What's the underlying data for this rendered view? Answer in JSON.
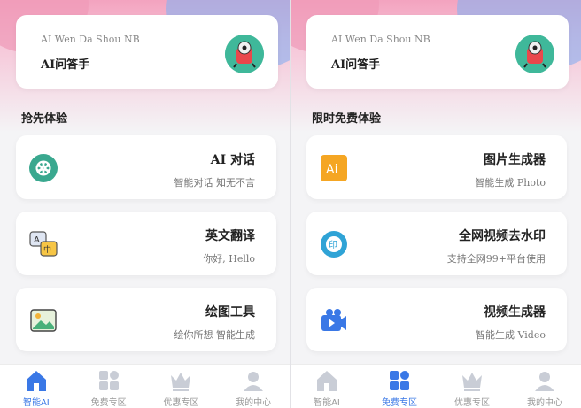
{
  "screens": [
    {
      "header": {
        "subtitle": "AI Wen Da Shou NB",
        "title": "AI问答手"
      },
      "section_title": "抢先体验",
      "cards": [
        {
          "title": "AI 对话",
          "desc": "智能对话 知无不言",
          "icon": "chat-ai-icon"
        },
        {
          "title": "英文翻译",
          "desc": "你好, Hello",
          "icon": "translate-icon"
        },
        {
          "title": "绘图工具",
          "desc": "绘你所想 智能生成",
          "icon": "image-icon"
        }
      ],
      "tabs": [
        {
          "label": "智能AI",
          "icon": "home-icon",
          "active": true
        },
        {
          "label": "免费专区",
          "icon": "grid-icon",
          "active": false
        },
        {
          "label": "优惠专区",
          "icon": "crown-icon",
          "active": false
        },
        {
          "label": "我的中心",
          "icon": "user-icon",
          "active": false
        }
      ]
    },
    {
      "header": {
        "subtitle": "AI Wen Da Shou NB",
        "title": "AI问答手"
      },
      "section_title": "限时免费体验",
      "cards": [
        {
          "title": "图片生成器",
          "desc": "智能生成 Photo",
          "icon": "ai-image-icon"
        },
        {
          "title": "全网视频去水印",
          "desc": "支持全网99+平台使用",
          "icon": "watermark-icon"
        },
        {
          "title": "视频生成器",
          "desc": "智能生成 Video",
          "icon": "video-icon"
        }
      ],
      "tabs": [
        {
          "label": "智能AI",
          "icon": "home-icon",
          "active": false
        },
        {
          "label": "免费专区",
          "icon": "grid-icon",
          "active": true
        },
        {
          "label": "优惠专区",
          "icon": "crown-icon",
          "active": false
        },
        {
          "label": "我的中心",
          "icon": "user-icon",
          "active": false
        }
      ]
    }
  ],
  "colors": {
    "accent": "#3a78e6",
    "inactive": "#c9cdd6",
    "avatar_bg": "#3fb89a"
  }
}
